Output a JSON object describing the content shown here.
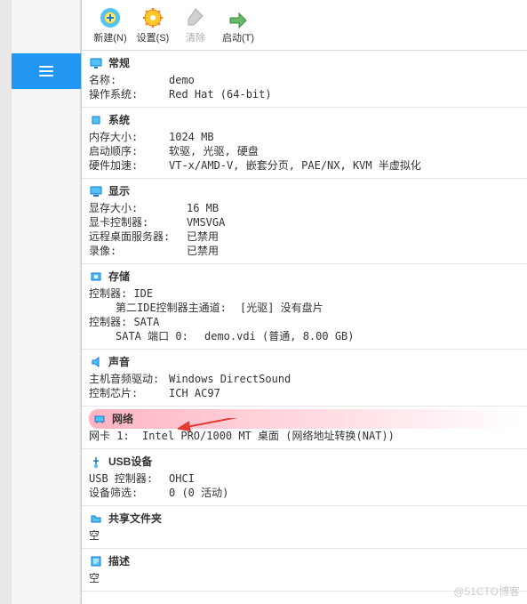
{
  "toolbar": {
    "new": "新建(N)",
    "settings": "设置(S)",
    "clear": "清除",
    "start": "启动(T)"
  },
  "sections": {
    "general": {
      "title": "常规",
      "name_k": "名称:",
      "name_v": "demo",
      "os_k": "操作系统:",
      "os_v": "Red Hat (64-bit)"
    },
    "system": {
      "title": "系统",
      "mem_k": "内存大小:",
      "mem_v": "1024 MB",
      "boot_k": "启动顺序:",
      "boot_v": "软驱, 光驱, 硬盘",
      "accel_k": "硬件加速:",
      "accel_v": "VT-x/AMD-V, 嵌套分页, PAE/NX, KVM 半虚拟化"
    },
    "display": {
      "title": "显示",
      "vram_k": "显存大小:",
      "vram_v": "16 MB",
      "gpu_k": "显卡控制器:",
      "gpu_v": "VMSVGA",
      "rdp_k": "远程桌面服务器:",
      "rdp_v": "已禁用",
      "rec_k": "录像:",
      "rec_v": "已禁用"
    },
    "storage": {
      "title": "存储",
      "ctrl1_k": "控制器: IDE",
      "ide2_k": "第二IDE控制器主通道:",
      "ide2_v": "[光驱] 没有盘片",
      "ctrl2_k": "控制器: SATA",
      "sata_k": "SATA 端口 0:",
      "sata_v": "demo.vdi (普通, 8.00 GB)"
    },
    "audio": {
      "title": "声音",
      "drv_k": "主机音频驱动:",
      "drv_v": "Windows DirectSound",
      "chip_k": "控制芯片:",
      "chip_v": "ICH AC97"
    },
    "network": {
      "title": "网络",
      "nic_k": "网卡 1:",
      "nic_v": "Intel PRO/1000 MT 桌面 (网络地址转换(NAT))"
    },
    "usb": {
      "title": "USB设备",
      "ctrl_k": "USB 控制器:",
      "ctrl_v": "OHCI",
      "filter_k": "设备筛选:",
      "filter_v": "0 (0 活动)"
    },
    "shared": {
      "title": "共享文件夹",
      "empty": "空"
    },
    "desc": {
      "title": "描述",
      "empty": "空"
    }
  },
  "watermark": "@51CTO博客"
}
